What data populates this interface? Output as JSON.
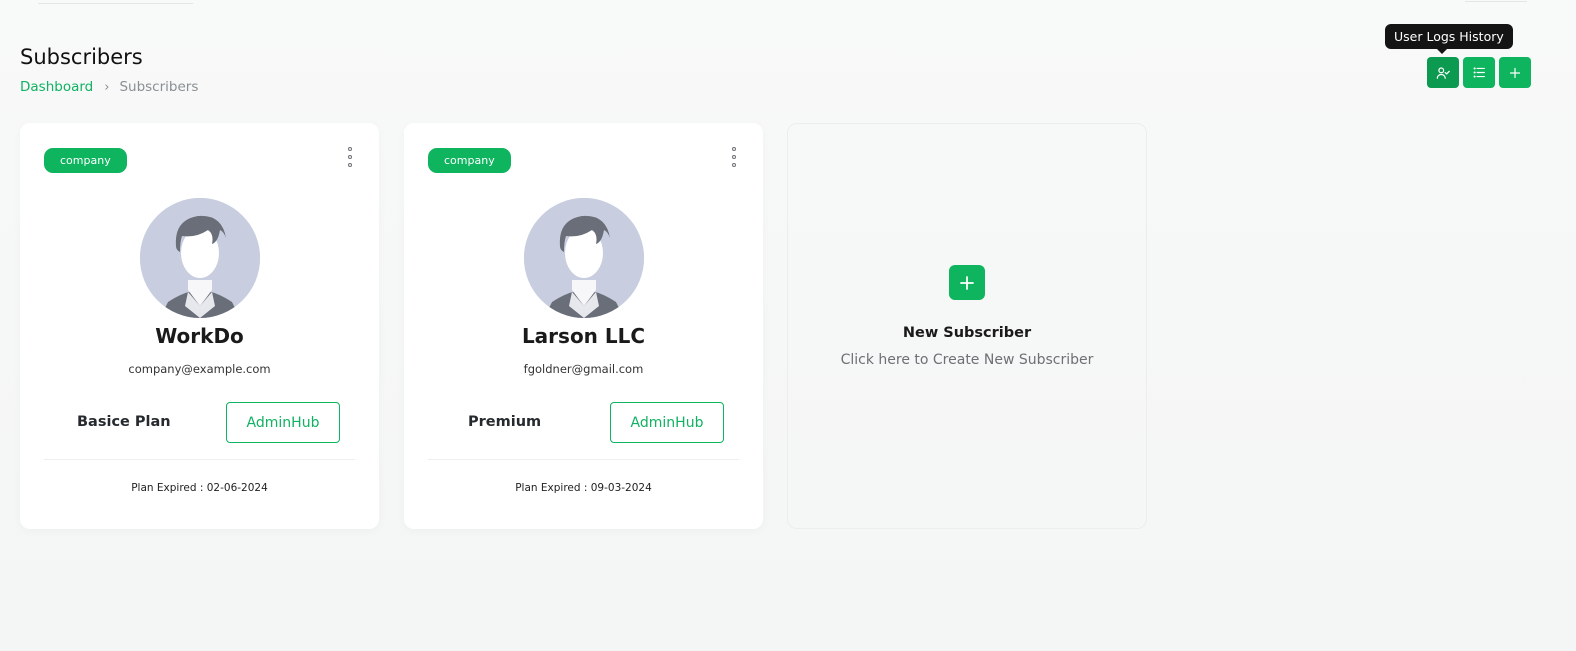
{
  "header": {
    "title": "Subscribers",
    "breadcrumb": {
      "home": "Dashboard",
      "separator": "›",
      "current": "Subscribers"
    },
    "tooltip": "User Logs History",
    "actions": [
      {
        "icon": "user-check-icon"
      },
      {
        "icon": "list-icon"
      },
      {
        "icon": "plus-icon"
      }
    ]
  },
  "cards": [
    {
      "badge": "company",
      "name": "WorkDo",
      "email": "company@example.com",
      "plan": "Basice Plan",
      "button": "AdminHub",
      "expired": "Plan Expired : 02-06-2024"
    },
    {
      "badge": "company",
      "name": "Larson LLC",
      "email": "fgoldner@gmail.com",
      "plan": "Premium",
      "button": "AdminHub",
      "expired": "Plan Expired : 09-03-2024"
    }
  ],
  "new_card": {
    "title": "New Subscriber",
    "subtitle": "Click here to Create New Subscriber"
  },
  "colors": {
    "accent": "#0fb45f",
    "accent_dark": "#0c9a51"
  }
}
